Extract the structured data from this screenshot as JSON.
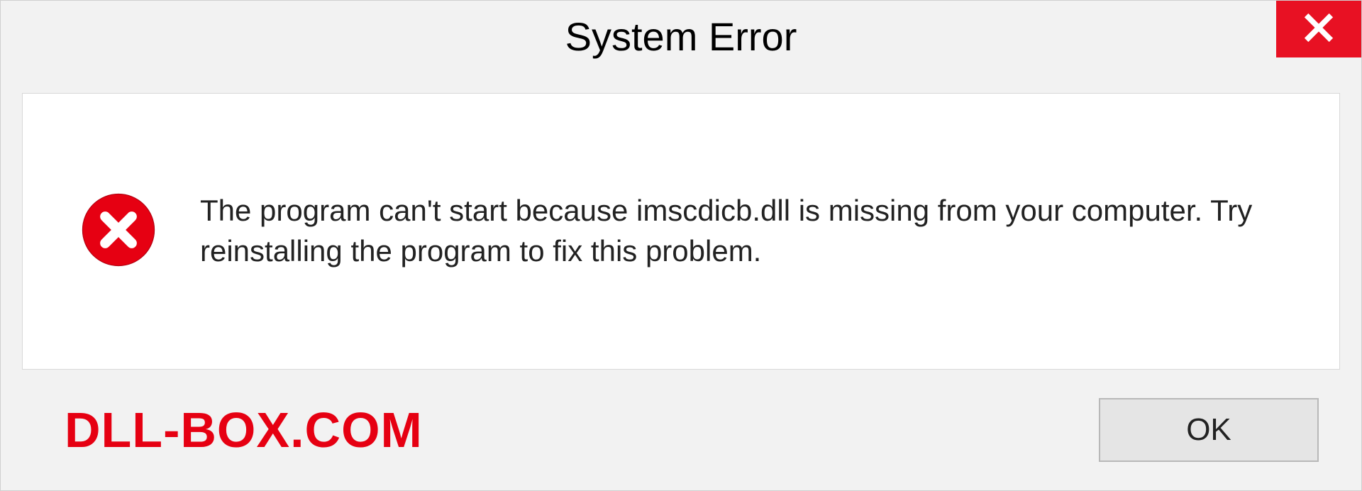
{
  "dialog": {
    "title": "System Error",
    "message": "The program can't start because imscdicb.dll is missing from your computer. Try reinstalling the program to fix this problem.",
    "ok_label": "OK"
  },
  "watermark": "DLL-BOX.COM"
}
